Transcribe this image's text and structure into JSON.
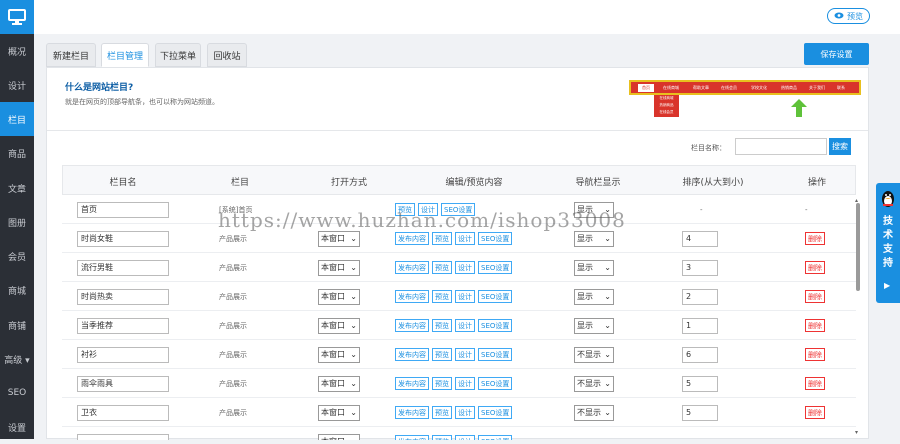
{
  "sidebar": {
    "items": [
      {
        "label": "概况"
      },
      {
        "label": "设计"
      },
      {
        "label": "栏目"
      },
      {
        "label": "商品"
      },
      {
        "label": "文章"
      },
      {
        "label": "图册"
      },
      {
        "label": "会员"
      },
      {
        "label": "商城"
      },
      {
        "label": "商铺"
      },
      {
        "label": "高级 ▾"
      },
      {
        "label": "SEO"
      },
      {
        "label": "设置"
      }
    ],
    "active_index": 2
  },
  "topbar": {
    "preview_label": "预览"
  },
  "tabs": [
    {
      "label": "新建栏目"
    },
    {
      "label": "栏目管理"
    },
    {
      "label": "下拉菜单"
    },
    {
      "label": "回收站"
    }
  ],
  "active_tab": 1,
  "save_label": "保存设置",
  "help": {
    "title": "什么是网站栏目?",
    "desc": "就是在网页的顶部导航条，也可以称为网站频道。"
  },
  "demo_nav": {
    "first": "首页",
    "items": [
      "在线商城",
      "帮助文章",
      "在线会员",
      "学校文化",
      "热销商品",
      "关于我们",
      "联系"
    ],
    "sub": [
      "在线商城",
      "热销商品",
      "在线会员"
    ]
  },
  "search": {
    "label": "栏目名称：",
    "button": "搜索"
  },
  "table": {
    "headers": [
      "栏目名",
      "栏目",
      "打开方式",
      "编辑/预览内容",
      "导航栏显示",
      "排序(从大到小)",
      "操作"
    ],
    "rows": [
      {
        "name": "首页",
        "type": "[系统]首页",
        "open": "",
        "actions": [
          "预览",
          "设计",
          "SEO设置"
        ],
        "nav": "显示",
        "order": "-",
        "op": "-"
      },
      {
        "name": "时尚女鞋",
        "type": "产品展示",
        "open": "本窗口",
        "actions": [
          "发布内容",
          "预览",
          "设计",
          "SEO设置"
        ],
        "nav": "显示",
        "order": "4",
        "op": "删除"
      },
      {
        "name": "流行男鞋",
        "type": "产品展示",
        "open": "本窗口",
        "actions": [
          "发布内容",
          "预览",
          "设计",
          "SEO设置"
        ],
        "nav": "显示",
        "order": "3",
        "op": "删除"
      },
      {
        "name": "时尚热卖",
        "type": "产品展示",
        "open": "本窗口",
        "actions": [
          "发布内容",
          "预览",
          "设计",
          "SEO设置"
        ],
        "nav": "显示",
        "order": "2",
        "op": "删除"
      },
      {
        "name": "当季推荐",
        "type": "产品展示",
        "open": "本窗口",
        "actions": [
          "发布内容",
          "预览",
          "设计",
          "SEO设置"
        ],
        "nav": "显示",
        "order": "1",
        "op": "删除"
      },
      {
        "name": "衬衫",
        "type": "产品展示",
        "open": "本窗口",
        "actions": [
          "发布内容",
          "预览",
          "设计",
          "SEO设置"
        ],
        "nav": "不显示",
        "order": "6",
        "op": "删除"
      },
      {
        "name": "雨伞雨具",
        "type": "产品展示",
        "open": "本窗口",
        "actions": [
          "发布内容",
          "预览",
          "设计",
          "SEO设置"
        ],
        "nav": "不显示",
        "order": "5",
        "op": "删除"
      },
      {
        "name": "卫衣",
        "type": "产品展示",
        "open": "本窗口",
        "actions": [
          "发布内容",
          "预览",
          "设计",
          "SEO设置"
        ],
        "nav": "不显示",
        "order": "5",
        "op": "删除"
      },
      {
        "name": "",
        "type": "",
        "open": "本窗口",
        "actions": [
          "发布内容",
          "预览",
          "设计",
          "SEO设置"
        ],
        "nav": "",
        "order": "",
        "op": ""
      }
    ]
  },
  "support": {
    "label": "技术支持"
  },
  "watermark": "https://www.huzhan.com/ishop33008"
}
